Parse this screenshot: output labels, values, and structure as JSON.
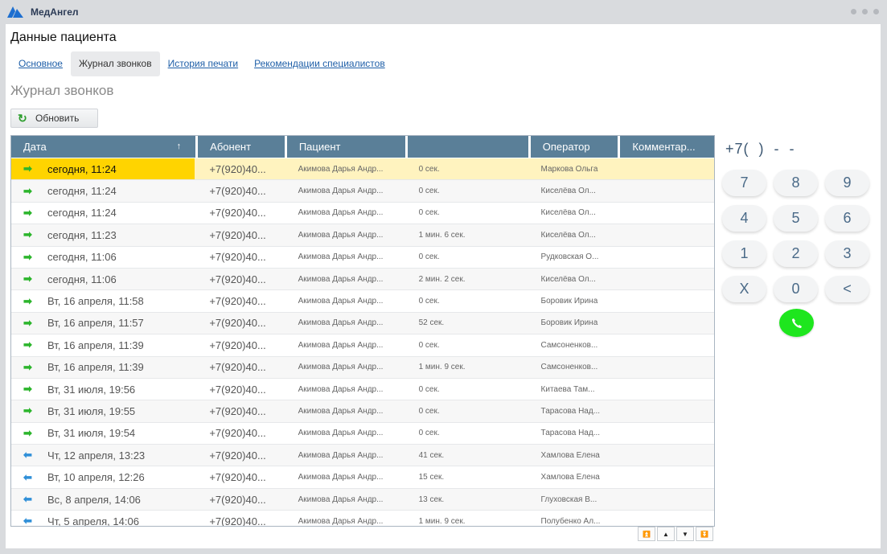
{
  "app": {
    "name": "МедАнгел"
  },
  "page_title": "Данные пациента",
  "tabs": [
    {
      "label": "Основное",
      "active": false
    },
    {
      "label": "Журнал звонков",
      "active": true
    },
    {
      "label": "История печати",
      "active": false
    },
    {
      "label": "Рекомендации специалистов",
      "active": false
    }
  ],
  "section_title": "Журнал звонков",
  "refresh_label": "Обновить",
  "table": {
    "columns": [
      "Дата",
      "Абонент",
      "Пациент",
      "",
      "Оператор",
      "Комментар..."
    ],
    "sort_indicator": "↑",
    "rows": [
      {
        "dir": "out",
        "date": "сегодня, 11:24",
        "phone": "+7(920)40...",
        "patient": "Акимова Дарья Андр...",
        "duration": "0 сек.",
        "operator": "Маркова Ольга",
        "comment": ""
      },
      {
        "dir": "out",
        "date": "сегодня, 11:24",
        "phone": "+7(920)40...",
        "patient": "Акимова Дарья Андр...",
        "duration": "0 сек.",
        "operator": "Киселёва Ол...",
        "comment": ""
      },
      {
        "dir": "out",
        "date": "сегодня, 11:24",
        "phone": "+7(920)40...",
        "patient": "Акимова Дарья Андр...",
        "duration": "0 сек.",
        "operator": "Киселёва Ол...",
        "comment": ""
      },
      {
        "dir": "out",
        "date": "сегодня, 11:23",
        "phone": "+7(920)40...",
        "patient": "Акимова Дарья Андр...",
        "duration": "1 мин. 6 сек.",
        "operator": "Киселёва Ол...",
        "comment": ""
      },
      {
        "dir": "out",
        "date": "сегодня, 11:06",
        "phone": "+7(920)40...",
        "patient": "Акимова Дарья Андр...",
        "duration": "0 сек.",
        "operator": "Рудковская О...",
        "comment": ""
      },
      {
        "dir": "out",
        "date": "сегодня, 11:06",
        "phone": "+7(920)40...",
        "patient": "Акимова Дарья Андр...",
        "duration": "2 мин. 2 сек.",
        "operator": "Киселёва Ол...",
        "comment": ""
      },
      {
        "dir": "out",
        "date": "Вт, 16 апреля, 11:58",
        "phone": "+7(920)40...",
        "patient": "Акимова Дарья Андр...",
        "duration": "0 сек.",
        "operator": "Боровик Ирина",
        "comment": ""
      },
      {
        "dir": "out",
        "date": "Вт, 16 апреля, 11:57",
        "phone": "+7(920)40...",
        "patient": "Акимова Дарья Андр...",
        "duration": "52 сек.",
        "operator": "Боровик Ирина",
        "comment": ""
      },
      {
        "dir": "out",
        "date": "Вт, 16 апреля, 11:39",
        "phone": "+7(920)40...",
        "patient": "Акимова Дарья Андр...",
        "duration": "0 сек.",
        "operator": "Самсоненков...",
        "comment": ""
      },
      {
        "dir": "out",
        "date": "Вт, 16 апреля, 11:39",
        "phone": "+7(920)40...",
        "patient": "Акимова Дарья Андр...",
        "duration": "1 мин. 9 сек.",
        "operator": "Самсоненков...",
        "comment": ""
      },
      {
        "dir": "out",
        "date": "Вт, 31 июля, 19:56",
        "phone": "+7(920)40...",
        "patient": "Акимова Дарья Андр...",
        "duration": "0 сек.",
        "operator": "Китаева Там...",
        "comment": ""
      },
      {
        "dir": "out",
        "date": "Вт, 31 июля, 19:55",
        "phone": "+7(920)40...",
        "patient": "Акимова Дарья Андр...",
        "duration": "0 сек.",
        "operator": "Тарасова Над...",
        "comment": ""
      },
      {
        "dir": "out",
        "date": "Вт, 31 июля, 19:54",
        "phone": "+7(920)40...",
        "patient": "Акимова Дарья Андр...",
        "duration": "0 сек.",
        "operator": "Тарасова Над...",
        "comment": ""
      },
      {
        "dir": "in",
        "date": "Чт, 12 апреля, 13:23",
        "phone": "+7(920)40...",
        "patient": "Акимова Дарья Андр...",
        "duration": "41 сек.",
        "operator": "Хамлова Елена",
        "comment": ""
      },
      {
        "dir": "in",
        "date": "Вт, 10 апреля, 12:26",
        "phone": "+7(920)40...",
        "patient": "Акимова Дарья Андр...",
        "duration": "15 сек.",
        "operator": "Хамлова Елена",
        "comment": ""
      },
      {
        "dir": "in",
        "date": "Вс, 8 апреля, 14:06",
        "phone": "+7(920)40...",
        "patient": "Акимова Дарья Андр...",
        "duration": "13 сек.",
        "operator": "Глуховская В...",
        "comment": ""
      },
      {
        "dir": "in",
        "date": "Чт, 5 апреля, 14:06",
        "phone": "+7(920)40...",
        "patient": "Акимова Дарья Андр...",
        "duration": "1 мин. 9 сек.",
        "operator": "Полубенко Ал...",
        "comment": ""
      }
    ],
    "selected_row": 0
  },
  "pager": [
    "⏫",
    "▲",
    "▼",
    "⏬"
  ],
  "dialer": {
    "display": "+7(  )  -  -",
    "keys": [
      "7",
      "8",
      "9",
      "4",
      "5",
      "6",
      "1",
      "2",
      "3",
      "X",
      "0",
      "<"
    ],
    "call_icon": "phone-icon"
  },
  "colors": {
    "header": "#5a7f98",
    "selected": "#ffd400",
    "selected_row": "#fff3bf",
    "call": "#1ee61e",
    "link": "#1f5fa8"
  }
}
